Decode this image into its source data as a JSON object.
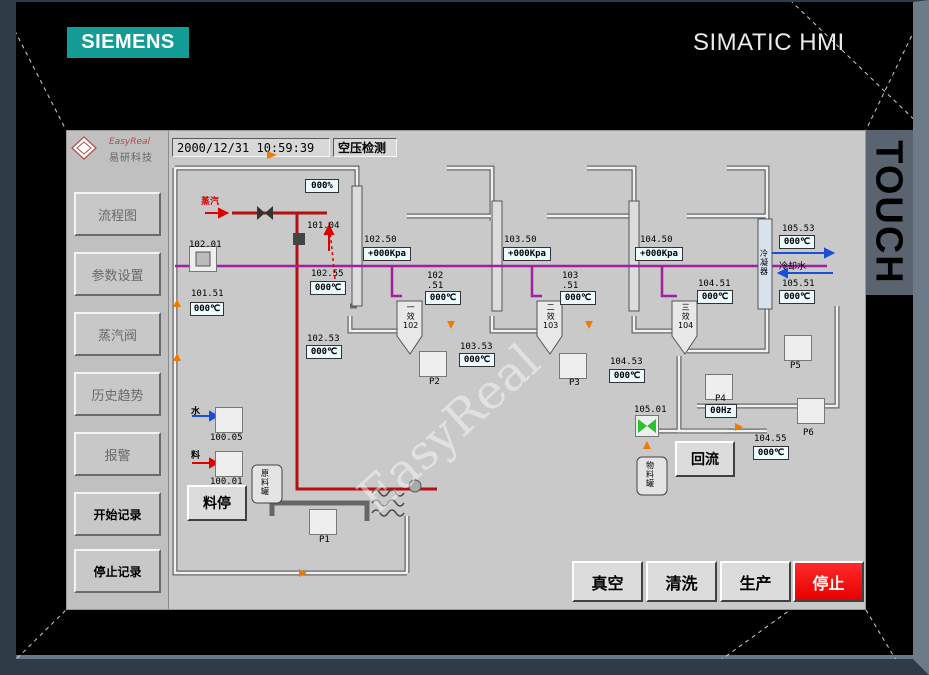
{
  "device": {
    "brand": "SIEMENS",
    "product": "SIMATIC HMI",
    "side_label": "TOUCH"
  },
  "company": {
    "name_en": "EasyReal",
    "name_cn": "易研科技",
    "watermark": "EasyReal"
  },
  "topbar": {
    "datetime": "2000/12/31  10:59:39",
    "status": "空压检测"
  },
  "nav": {
    "items": [
      {
        "label": "流程图"
      },
      {
        "label": "参数设置"
      },
      {
        "label": "蒸汽阀"
      },
      {
        "label": "历史趋势"
      },
      {
        "label": "报警"
      },
      {
        "label": "开始记录"
      },
      {
        "label": "停止记录"
      }
    ]
  },
  "process": {
    "steam_label": "蒸汽",
    "water_label": "水",
    "feed_label": "料",
    "cold_water_label": "冷却水",
    "valve_open": "000%",
    "tags": {
      "t101_01": "102.01",
      "t101_51": "101.51",
      "t101_51_val": "000℃",
      "t101_04": "101.04",
      "t102_55": "102.55",
      "t102_55_val": "000℃",
      "t102_53": "102.53",
      "t102_53_val": "000℃",
      "t102_50": "102.50",
      "t102_50_val": "+000Kpa",
      "t102_51": "102\n.51",
      "t102_51_val": "000℃",
      "t103_50": "103.50",
      "t103_50_val": "+000Kpa",
      "t103_51": "103\n.51",
      "t103_51_val": "000℃",
      "t103_53": "103.53",
      "t103_53_val": "000℃",
      "t104_50": "104.50",
      "t104_50_val": "+000Kpa",
      "t104_51": "104.51",
      "t104_51_val": "000℃",
      "t104_53": "104.53",
      "t104_53_val": "000℃",
      "t104_55": "104.55",
      "t104_55_val": "000℃",
      "t105_53": "105.53",
      "t105_53_val": "000℃",
      "t105_51": "105.51",
      "t105_51_val": "000℃",
      "t105_01": "105.01",
      "t100_05": "100.05",
      "t100_01": "100.01",
      "p4_val": "00Hz"
    },
    "vessels": {
      "v102": "一\n效\n102",
      "v103": "二\n效\n103",
      "v104": "三\n效\n104",
      "condenser": "冷\n凝\n器",
      "raw_tank": "原\n料\n罐",
      "product_tank": "物\n料\n罐"
    },
    "pumps": {
      "p1": "P1",
      "p2": "P2",
      "p3": "P3",
      "p4": "P4",
      "p5": "P5",
      "p6": "P6"
    }
  },
  "buttons": {
    "feed_stop": "料停",
    "reflux": "回流",
    "vacuum": "真空",
    "clean": "清洗",
    "produce": "生产",
    "stop": "停止"
  }
}
